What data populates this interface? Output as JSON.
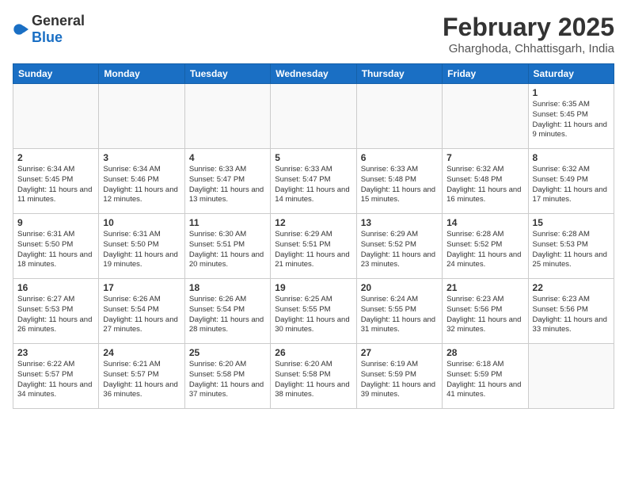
{
  "header": {
    "logo_general": "General",
    "logo_blue": "Blue",
    "month_year": "February 2025",
    "location": "Gharghoda, Chhattisgarh, India"
  },
  "weekdays": [
    "Sunday",
    "Monday",
    "Tuesday",
    "Wednesday",
    "Thursday",
    "Friday",
    "Saturday"
  ],
  "weeks": [
    [
      {
        "day": "",
        "info": ""
      },
      {
        "day": "",
        "info": ""
      },
      {
        "day": "",
        "info": ""
      },
      {
        "day": "",
        "info": ""
      },
      {
        "day": "",
        "info": ""
      },
      {
        "day": "",
        "info": ""
      },
      {
        "day": "1",
        "info": "Sunrise: 6:35 AM\nSunset: 5:45 PM\nDaylight: 11 hours and 9 minutes."
      }
    ],
    [
      {
        "day": "2",
        "info": "Sunrise: 6:34 AM\nSunset: 5:45 PM\nDaylight: 11 hours and 11 minutes."
      },
      {
        "day": "3",
        "info": "Sunrise: 6:34 AM\nSunset: 5:46 PM\nDaylight: 11 hours and 12 minutes."
      },
      {
        "day": "4",
        "info": "Sunrise: 6:33 AM\nSunset: 5:47 PM\nDaylight: 11 hours and 13 minutes."
      },
      {
        "day": "5",
        "info": "Sunrise: 6:33 AM\nSunset: 5:47 PM\nDaylight: 11 hours and 14 minutes."
      },
      {
        "day": "6",
        "info": "Sunrise: 6:33 AM\nSunset: 5:48 PM\nDaylight: 11 hours and 15 minutes."
      },
      {
        "day": "7",
        "info": "Sunrise: 6:32 AM\nSunset: 5:48 PM\nDaylight: 11 hours and 16 minutes."
      },
      {
        "day": "8",
        "info": "Sunrise: 6:32 AM\nSunset: 5:49 PM\nDaylight: 11 hours and 17 minutes."
      }
    ],
    [
      {
        "day": "9",
        "info": "Sunrise: 6:31 AM\nSunset: 5:50 PM\nDaylight: 11 hours and 18 minutes."
      },
      {
        "day": "10",
        "info": "Sunrise: 6:31 AM\nSunset: 5:50 PM\nDaylight: 11 hours and 19 minutes."
      },
      {
        "day": "11",
        "info": "Sunrise: 6:30 AM\nSunset: 5:51 PM\nDaylight: 11 hours and 20 minutes."
      },
      {
        "day": "12",
        "info": "Sunrise: 6:29 AM\nSunset: 5:51 PM\nDaylight: 11 hours and 21 minutes."
      },
      {
        "day": "13",
        "info": "Sunrise: 6:29 AM\nSunset: 5:52 PM\nDaylight: 11 hours and 23 minutes."
      },
      {
        "day": "14",
        "info": "Sunrise: 6:28 AM\nSunset: 5:52 PM\nDaylight: 11 hours and 24 minutes."
      },
      {
        "day": "15",
        "info": "Sunrise: 6:28 AM\nSunset: 5:53 PM\nDaylight: 11 hours and 25 minutes."
      }
    ],
    [
      {
        "day": "16",
        "info": "Sunrise: 6:27 AM\nSunset: 5:53 PM\nDaylight: 11 hours and 26 minutes."
      },
      {
        "day": "17",
        "info": "Sunrise: 6:26 AM\nSunset: 5:54 PM\nDaylight: 11 hours and 27 minutes."
      },
      {
        "day": "18",
        "info": "Sunrise: 6:26 AM\nSunset: 5:54 PM\nDaylight: 11 hours and 28 minutes."
      },
      {
        "day": "19",
        "info": "Sunrise: 6:25 AM\nSunset: 5:55 PM\nDaylight: 11 hours and 30 minutes."
      },
      {
        "day": "20",
        "info": "Sunrise: 6:24 AM\nSunset: 5:55 PM\nDaylight: 11 hours and 31 minutes."
      },
      {
        "day": "21",
        "info": "Sunrise: 6:23 AM\nSunset: 5:56 PM\nDaylight: 11 hours and 32 minutes."
      },
      {
        "day": "22",
        "info": "Sunrise: 6:23 AM\nSunset: 5:56 PM\nDaylight: 11 hours and 33 minutes."
      }
    ],
    [
      {
        "day": "23",
        "info": "Sunrise: 6:22 AM\nSunset: 5:57 PM\nDaylight: 11 hours and 34 minutes."
      },
      {
        "day": "24",
        "info": "Sunrise: 6:21 AM\nSunset: 5:57 PM\nDaylight: 11 hours and 36 minutes."
      },
      {
        "day": "25",
        "info": "Sunrise: 6:20 AM\nSunset: 5:58 PM\nDaylight: 11 hours and 37 minutes."
      },
      {
        "day": "26",
        "info": "Sunrise: 6:20 AM\nSunset: 5:58 PM\nDaylight: 11 hours and 38 minutes."
      },
      {
        "day": "27",
        "info": "Sunrise: 6:19 AM\nSunset: 5:59 PM\nDaylight: 11 hours and 39 minutes."
      },
      {
        "day": "28",
        "info": "Sunrise: 6:18 AM\nSunset: 5:59 PM\nDaylight: 11 hours and 41 minutes."
      },
      {
        "day": "",
        "info": ""
      }
    ]
  ]
}
